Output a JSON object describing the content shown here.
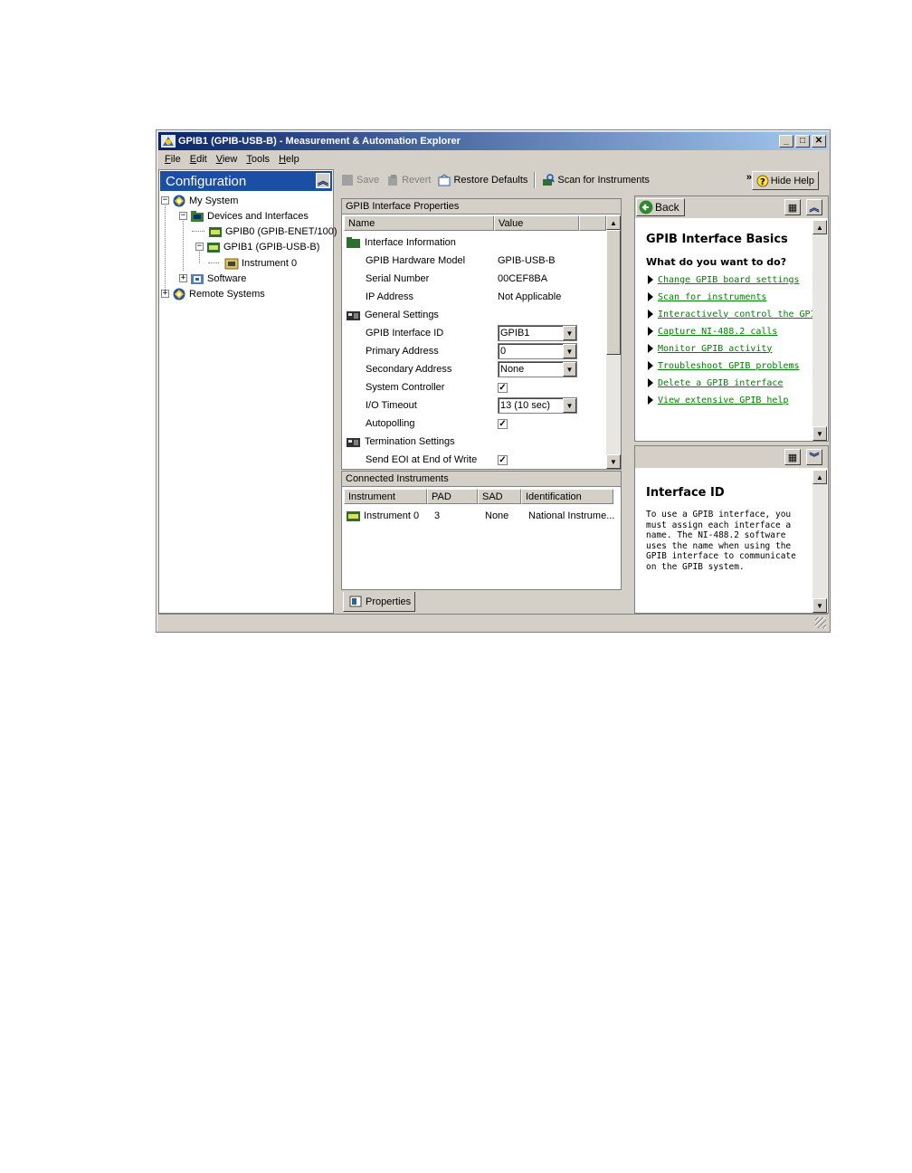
{
  "window": {
    "title": "GPIB1 (GPIB-USB-B) - Measurement & Automation Explorer",
    "controls": {
      "minimize": "_",
      "maximize": "□",
      "close": "✕"
    }
  },
  "menu": [
    "File",
    "Edit",
    "View",
    "Tools",
    "Help"
  ],
  "config": {
    "header": "Configuration",
    "tree": [
      {
        "label": "My System",
        "expander": "−",
        "icon": "computer-icon"
      },
      {
        "label": "Devices and Interfaces",
        "expander": "−",
        "icon": "devices-folder-icon"
      },
      {
        "label": "GPIB0 (GPIB-ENET/100)",
        "icon": "gpib-board-icon"
      },
      {
        "label": "GPIB1 (GPIB-USB-B)",
        "expander": "−",
        "icon": "gpib-board-icon"
      },
      {
        "label": "Instrument 0",
        "icon": "instrument-icon"
      },
      {
        "label": "Software",
        "expander": "+",
        "icon": "software-folder-icon"
      },
      {
        "label": "Remote Systems",
        "expander": "+",
        "icon": "remote-systems-icon"
      }
    ]
  },
  "toolbar": {
    "save": "Save",
    "revert": "Revert",
    "restore_defaults": "Restore Defaults",
    "scan": "Scan for Instruments",
    "more": "»",
    "hide_help": "Hide Help"
  },
  "properties": {
    "title": "GPIB Interface Properties",
    "col_name": "Name",
    "col_value": "Value",
    "rows": [
      {
        "category": "Interface Information"
      },
      {
        "label": "GPIB Hardware Model",
        "value": "GPIB-USB-B"
      },
      {
        "label": "Serial Number",
        "value": "00CEF8BA"
      },
      {
        "label": "IP Address",
        "value": "Not Applicable"
      },
      {
        "category": "General Settings"
      },
      {
        "label": "GPIB Interface ID",
        "value": "GPIB1"
      },
      {
        "label": "Primary Address",
        "value": "0"
      },
      {
        "label": "Secondary Address",
        "value": "None"
      },
      {
        "label": "System Controller",
        "checked": "✓"
      },
      {
        "label": "I/O Timeout",
        "value": "13 (10 sec)"
      },
      {
        "label": "Autopolling",
        "checked": "✓"
      },
      {
        "category": "Termination Settings"
      },
      {
        "label": "Send EOI at End of Write",
        "checked": "✓"
      }
    ]
  },
  "connected": {
    "title": "Connected Instruments",
    "headers": [
      "Instrument",
      "PAD",
      "SAD",
      "Identification"
    ],
    "rows": [
      {
        "instrument": "Instrument 0",
        "pad": "3",
        "sad": "None",
        "identification": "National Instrume..."
      }
    ]
  },
  "tab": {
    "properties": "Properties"
  },
  "help": {
    "back": "Back",
    "title": "GPIB Interface Basics",
    "subtitle": "What do you want to do?",
    "links": [
      "Change GPIB board settings",
      "Scan for instruments",
      "Interactively control the GPIB",
      "Capture NI-488.2 calls",
      "Monitor GPIB activity",
      "Troubleshoot GPIB problems",
      "Delete a GPIB interface",
      "View extensive GPIB help"
    ],
    "topic_title": "Interface ID",
    "topic_text": "To use a GPIB interface, you must assign each interface a name. The NI-488.2 software uses the name when using the GPIB interface to communicate on the GPIB system."
  }
}
